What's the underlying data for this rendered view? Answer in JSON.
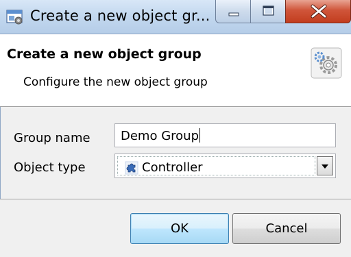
{
  "window": {
    "title": "Create a new object gr...",
    "app_icon": "app-window-icon",
    "controls": [
      "minimize-icon",
      "maximize-icon",
      "close-icon"
    ]
  },
  "header": {
    "title": "Create a new object group",
    "subtitle": "Configure the new object group",
    "icon": "gear-settings-icon"
  },
  "form": {
    "group_name_label": "Group name",
    "group_name_value": "Demo Group",
    "object_type_label": "Object type",
    "object_type_value": "Controller",
    "object_type_icon": "puzzle-piece-icon"
  },
  "buttons": {
    "ok_label": "OK",
    "cancel_label": "Cancel"
  },
  "colors": {
    "titlebar": "#c3d8ef",
    "close_button": "#c94a2d",
    "header_bg": "#ffffff",
    "dialog_bg": "#f0f0f0",
    "ok_button": "#bee6fd"
  }
}
